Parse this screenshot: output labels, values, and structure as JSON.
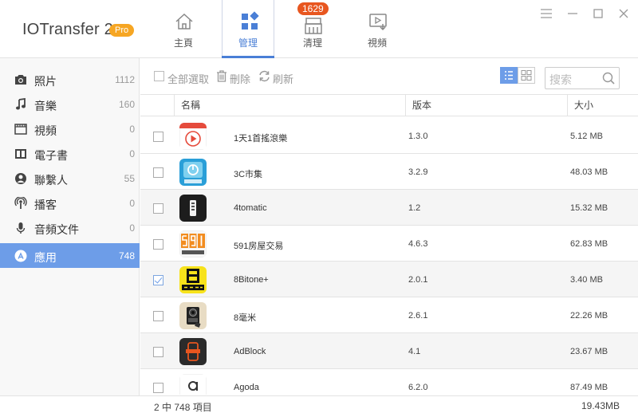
{
  "app": {
    "title": "IOTransfer 2",
    "badge": "Pro"
  },
  "nav": {
    "tabs": [
      {
        "label": "主頁",
        "icon": "home-icon"
      },
      {
        "label": "管理",
        "icon": "manage-grid-icon",
        "active": true
      },
      {
        "label": "清理",
        "icon": "broom-icon",
        "badge": "1629"
      },
      {
        "label": "視頻",
        "icon": "video-download-icon"
      }
    ]
  },
  "window_controls": [
    "menu-icon",
    "minimize-icon",
    "maximize-icon",
    "close-icon"
  ],
  "sidebar": {
    "items": [
      {
        "label": "照片",
        "count": "1112",
        "icon": "camera-icon"
      },
      {
        "label": "音樂",
        "count": "160",
        "icon": "music-note-icon"
      },
      {
        "label": "視頻",
        "count": "0",
        "icon": "film-icon"
      },
      {
        "label": "電子書",
        "count": "0",
        "icon": "book-icon"
      },
      {
        "label": "聯繫人",
        "count": "55",
        "icon": "contact-icon"
      },
      {
        "label": "播客",
        "count": "0",
        "icon": "podcast-icon"
      },
      {
        "label": "音頻文件",
        "count": "0",
        "icon": "microphone-icon"
      },
      {
        "label": "應用",
        "count": "748",
        "icon": "app-store-icon",
        "active": true
      }
    ]
  },
  "toolbar": {
    "select_all": "全部選取",
    "delete": "刪除",
    "refresh": "刷新",
    "search_placeholder": "搜索"
  },
  "table": {
    "columns": {
      "name": "名稱",
      "version": "版本",
      "size": "大小"
    },
    "rows": [
      {
        "name": "1天1首搖滾樂",
        "version": "1.3.0",
        "size": "5.12 MB",
        "checked": false,
        "icon": "play-button-app-icon"
      },
      {
        "name": "3C市集",
        "version": "3.2.9",
        "size": "48.03 MB",
        "checked": false,
        "icon": "power-app-icon"
      },
      {
        "name": "4tomatic",
        "version": "1.2",
        "size": "15.32 MB",
        "checked": false,
        "icon": "dark-bar-app-icon"
      },
      {
        "name": "591房屋交易",
        "version": "4.6.3",
        "size": "62.83 MB",
        "checked": false,
        "icon": "591-app-icon"
      },
      {
        "name": "8Bitone+",
        "version": "2.0.1",
        "size": "3.40 MB",
        "checked": true,
        "icon": "8bit-app-icon"
      },
      {
        "name": "8毫米",
        "version": "2.6.1",
        "size": "22.26 MB",
        "checked": false,
        "icon": "camera-app-icon"
      },
      {
        "name": "AdBlock",
        "version": "4.1",
        "size": "23.67 MB",
        "checked": false,
        "icon": "adblock-app-icon"
      },
      {
        "name": "Agoda",
        "version": "6.2.0",
        "size": "87.49 MB",
        "checked": false,
        "icon": "agoda-app-icon"
      }
    ]
  },
  "footer": {
    "selection": "2 中 748 項目",
    "total_size": "19.43MB"
  },
  "colors": {
    "accent": "#4a7fd6",
    "sidebar_active": "#6d9de8",
    "badge": "#e8561f",
    "pro": "#f6a623"
  }
}
